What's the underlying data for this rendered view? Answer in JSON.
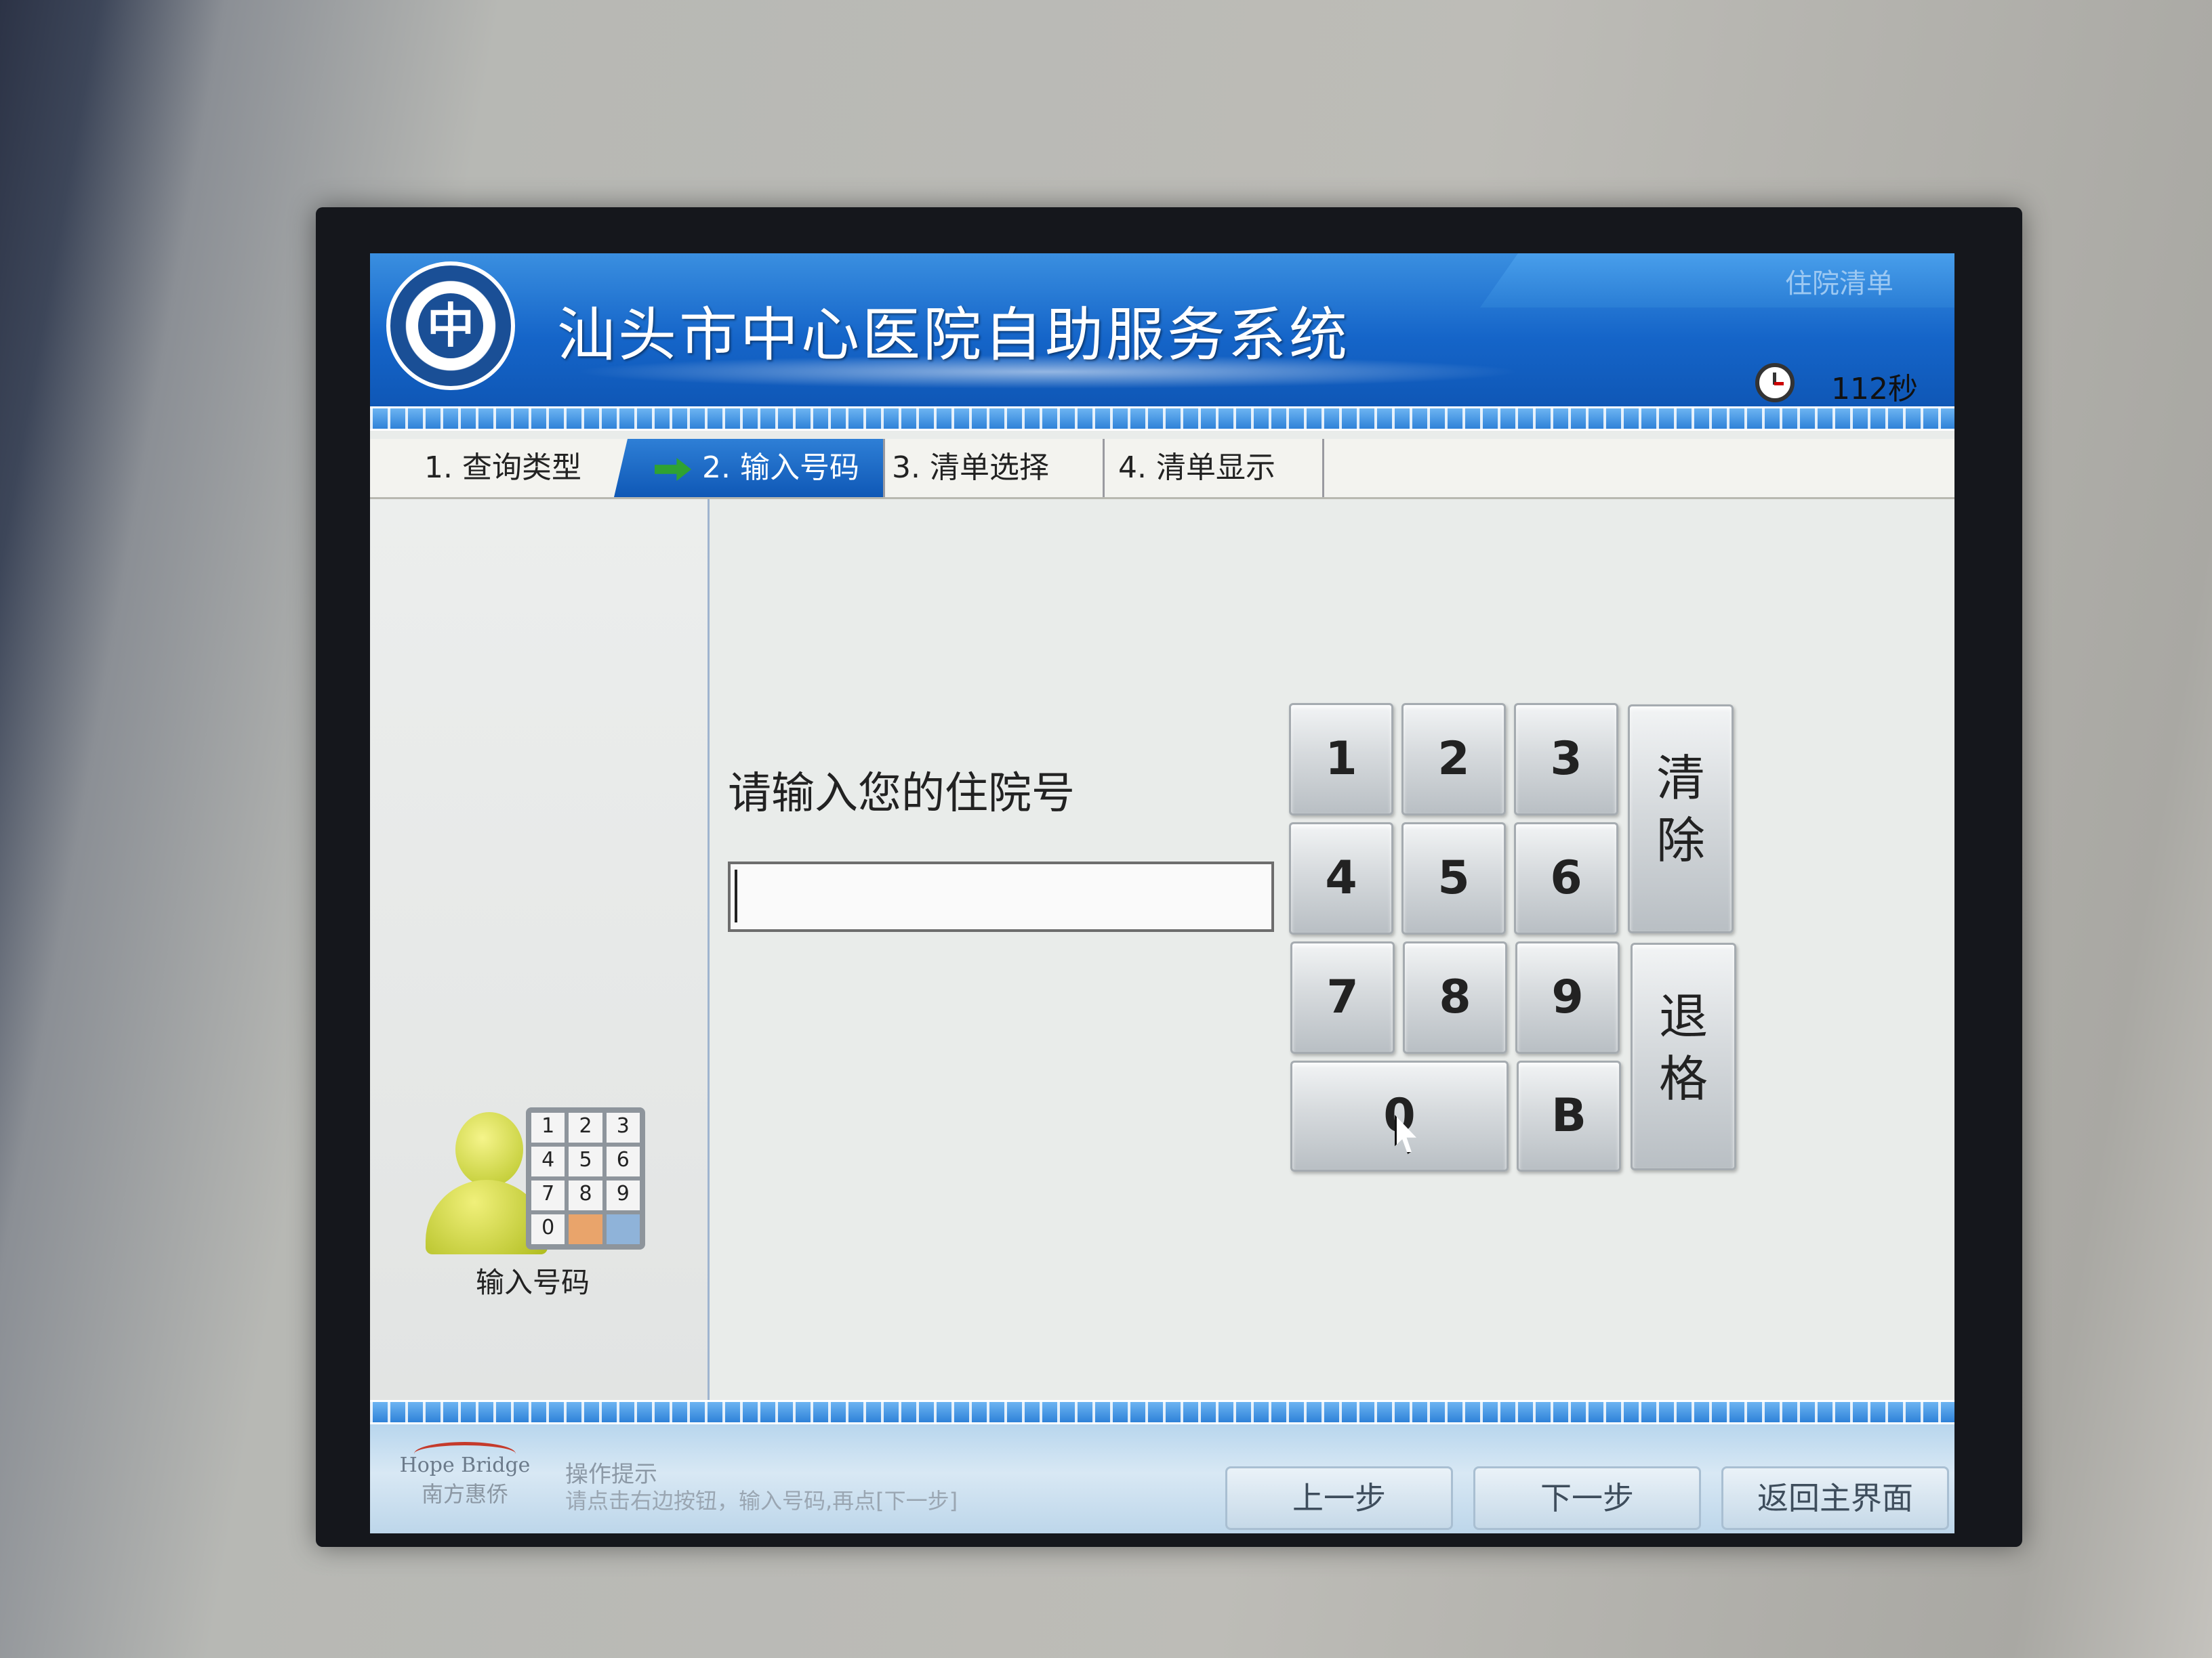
{
  "header": {
    "app_title": "汕头市中心医院自助服务系统",
    "page_label": "住院清单",
    "countdown": "112秒",
    "logo_icon": "hospital-emblem"
  },
  "steps": [
    {
      "label": "1. 查询类型",
      "active": false
    },
    {
      "label": "2. 输入号码",
      "active": true
    },
    {
      "label": "3. 清单选择",
      "active": false
    },
    {
      "label": "4. 清单显示",
      "active": false
    }
  ],
  "sidebar": {
    "label": "输入号码",
    "icon": "person-keypad-icon",
    "keypad_digits": [
      "1",
      "2",
      "3",
      "4",
      "5",
      "6",
      "7",
      "8",
      "9",
      "0"
    ]
  },
  "main": {
    "prompt": "请输入您的住院号",
    "input_value": ""
  },
  "keypad": {
    "keys": [
      "1",
      "2",
      "3",
      "4",
      "5",
      "6",
      "7",
      "8",
      "9",
      "0",
      "B"
    ],
    "clear_label": "清除",
    "backspace_label": "退格"
  },
  "footer": {
    "logo_en": "Hope Bridge",
    "logo_cn": "南方惠侨",
    "hint_title": "操作提示",
    "hint_text": "请点击右边按钮，输入号码,再点[下一步]",
    "prev_label": "上一步",
    "next_label": "下一步",
    "home_label": "返回主界面"
  },
  "colors": {
    "header_blue": "#1565c9",
    "active_step": "#0f58b6",
    "arrow_green": "#2fa232"
  }
}
